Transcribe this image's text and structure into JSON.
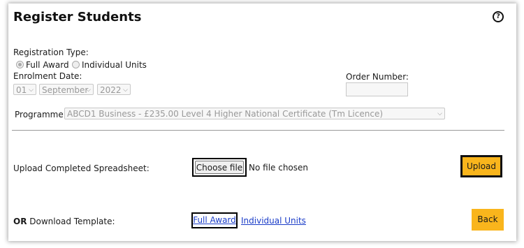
{
  "header": {
    "title": "Register Students",
    "help_icon": "?"
  },
  "registration": {
    "type_label": "Registration Type:",
    "options": [
      {
        "label": "Full Award",
        "checked": true
      },
      {
        "label": "Individual Units",
        "checked": false
      }
    ]
  },
  "enrolment": {
    "label": "Enrolment Date:",
    "day": "01",
    "month": "September",
    "year": "2022"
  },
  "order": {
    "label": "Order Number:",
    "value": ""
  },
  "programme": {
    "label": "Programme:",
    "value": "ABCD1 Business - £235.00 Level 4 Higher National Certificate (Tm Licence)"
  },
  "upload": {
    "label": "Upload Completed Spreadsheet:",
    "choose_label": "Choose file",
    "status": "No file chosen",
    "button": "Upload"
  },
  "download": {
    "or_label": "OR",
    "label": "Download Template:",
    "full_award": "Full Award",
    "individual_units": "Individual Units",
    "back": "Back"
  },
  "colors": {
    "accent": "#f9b51c",
    "link": "#1a3cc8"
  }
}
